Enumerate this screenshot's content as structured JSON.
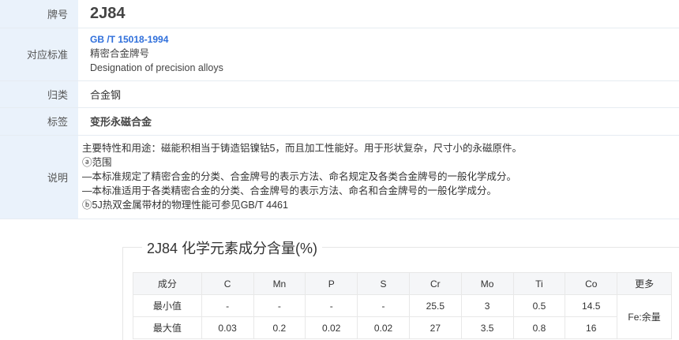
{
  "info": {
    "grade": {
      "label": "牌号",
      "value": "2J84"
    },
    "standard": {
      "label": "对应标准",
      "code": "GB /T 15018-1994",
      "name_cn": "精密合金牌号",
      "name_en": "Designation of precision alloys"
    },
    "category": {
      "label": "归类",
      "value": "合金钢"
    },
    "tag": {
      "label": "标签",
      "value": "变形永磁合金"
    },
    "description": {
      "label": "说明",
      "lines": [
        "主要特性和用途：磁能积相当于铸造铝镍钴5，而且加工性能好。用于形状复杂，尺寸小的永磁原件。",
        "ⓐ范围",
        "—本标准规定了精密合金的分类、合金牌号的表示方法、命名规定及各类合金牌号的一般化学成分。",
        "—本标准适用于各类精密合金的分类、合金牌号的表示方法、命名和合金牌号的一般化学成分。",
        "ⓑ5J热双金属带材的物理性能可参见GB/T 4461"
      ]
    }
  },
  "chemistry": {
    "title": "2J84 化学元素成分含量(%)",
    "headers": [
      "成分",
      "C",
      "Mn",
      "P",
      "S",
      "Cr",
      "Mo",
      "Ti",
      "Co",
      "更多"
    ],
    "rows": [
      {
        "label": "最小值",
        "values": [
          "-",
          "-",
          "-",
          "-",
          "25.5",
          "3",
          "0.5",
          "14.5"
        ]
      },
      {
        "label": "最大值",
        "values": [
          "0.03",
          "0.2",
          "0.02",
          "0.02",
          "27",
          "3.5",
          "0.8",
          "16"
        ]
      }
    ],
    "more": "Fe:余量"
  }
}
